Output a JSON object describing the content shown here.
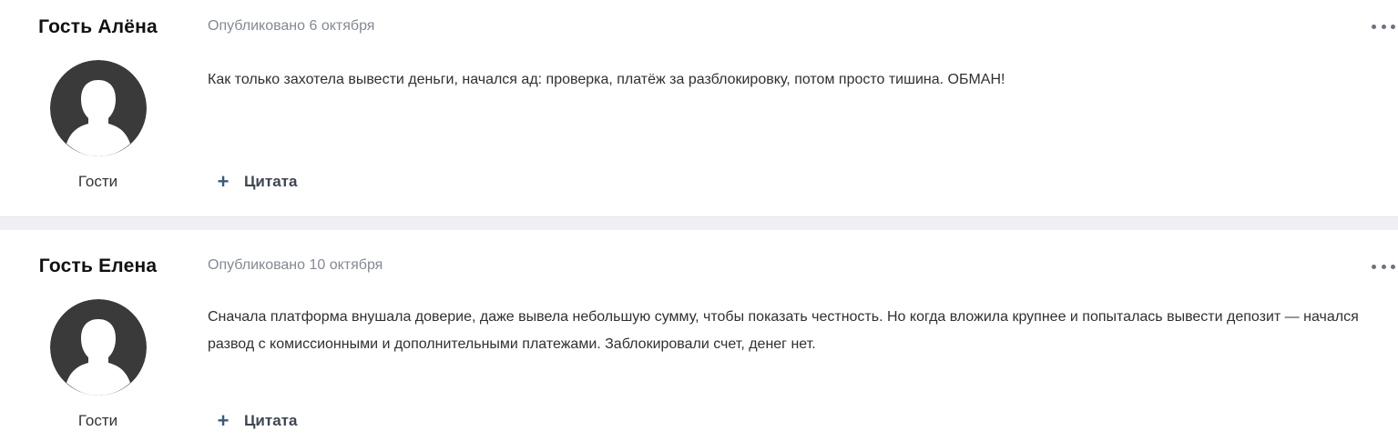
{
  "posts": [
    {
      "author": "Гость Алёна",
      "group": "Гости",
      "date": "Опубликовано 6 октября",
      "content": "Как только захотела вывести деньги, начался ад: проверка, платёж за разблокировку, потом просто тишина. ОБМАН!",
      "quote_label": "Цитата",
      "quote_icon": "plus-icon",
      "menu_icon": "ellipsis-icon",
      "avatar_icon": "default-user-silhouette"
    },
    {
      "author": "Гость Елена",
      "group": "Гости",
      "date": "Опубликовано 10 октября",
      "content": "Сначала платформа внушала доверие, даже вывела небольшую сумму, чтобы показать честность. Но когда вложила крупнее и попыталась вывести депозит — начался развод с комиссионными и дополнительными платежами. Заблокировали счет, денег нет.",
      "quote_label": "Цитата",
      "quote_icon": "plus-icon",
      "menu_icon": "ellipsis-icon",
      "avatar_icon": "default-user-silhouette"
    }
  ],
  "colors": {
    "avatar_bg": "#3a3a3a",
    "avatar_figure": "#ffffff",
    "date_text": "#848a94",
    "quote_accent": "#3c5a7d",
    "separator": "#eef0f3"
  }
}
